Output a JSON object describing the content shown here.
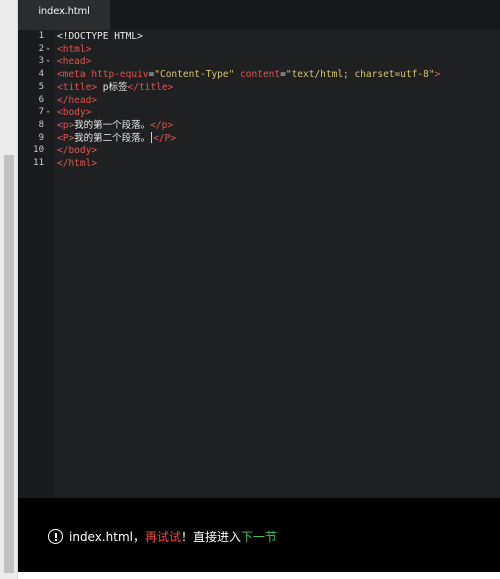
{
  "tab": {
    "label": "index.html"
  },
  "code": {
    "lines": [
      {
        "num": "1",
        "fold": "",
        "parts": [
          [
            "doctype",
            "<!DOCTYPE HTML>"
          ]
        ]
      },
      {
        "num": "2",
        "fold": "▾",
        "parts": [
          [
            "tag",
            "<html>"
          ]
        ]
      },
      {
        "num": "3",
        "fold": "▾",
        "parts": [
          [
            "tag",
            "<head>"
          ]
        ]
      },
      {
        "num": "4",
        "fold": "",
        "parts": [
          [
            "tag",
            "<meta "
          ],
          [
            "attr",
            "http-equiv"
          ],
          [
            "txt",
            "="
          ],
          [
            "str",
            "\"Content-Type\""
          ],
          [
            "txt",
            " "
          ],
          [
            "attr",
            "content"
          ],
          [
            "txt",
            "="
          ],
          [
            "str",
            "\"text/html; charset=utf-8\""
          ],
          [
            "tag",
            ">"
          ]
        ]
      },
      {
        "num": "5",
        "fold": "",
        "parts": [
          [
            "tag",
            "<title>"
          ],
          [
            "txt",
            " p标签"
          ],
          [
            "tag",
            "</title>"
          ]
        ]
      },
      {
        "num": "6",
        "fold": "",
        "parts": [
          [
            "tag",
            "</head>"
          ]
        ]
      },
      {
        "num": "7",
        "fold": "▾",
        "parts": [
          [
            "tag",
            "<body>"
          ]
        ]
      },
      {
        "num": "8",
        "fold": "",
        "parts": [
          [
            "tag",
            "<p>"
          ],
          [
            "txt",
            "我的第一个段落。"
          ],
          [
            "tag",
            "</p>"
          ]
        ]
      },
      {
        "num": "9",
        "fold": "",
        "parts": [
          [
            "tag",
            "<P>"
          ],
          [
            "txt",
            "我的第二个段落。"
          ],
          [
            "cursor",
            ""
          ],
          [
            "tag",
            "</P>"
          ]
        ]
      },
      {
        "num": "10",
        "fold": "",
        "parts": [
          [
            "tag",
            "</body>"
          ]
        ]
      },
      {
        "num": "11",
        "fold": "",
        "parts": [
          [
            "tag",
            "</html>"
          ]
        ]
      }
    ]
  },
  "result": {
    "icon": "info-circle-icon",
    "filename": "index.html",
    "separator": "，",
    "retry": "再试试",
    "exclaim": "！",
    "direct": "直接进入",
    "next": "下一节"
  },
  "colors": {
    "editor_bg": "#1e2022",
    "tag": "#e5534b",
    "string": "#d8c36a",
    "retry": "#f0483e",
    "next": "#3cc85a"
  }
}
